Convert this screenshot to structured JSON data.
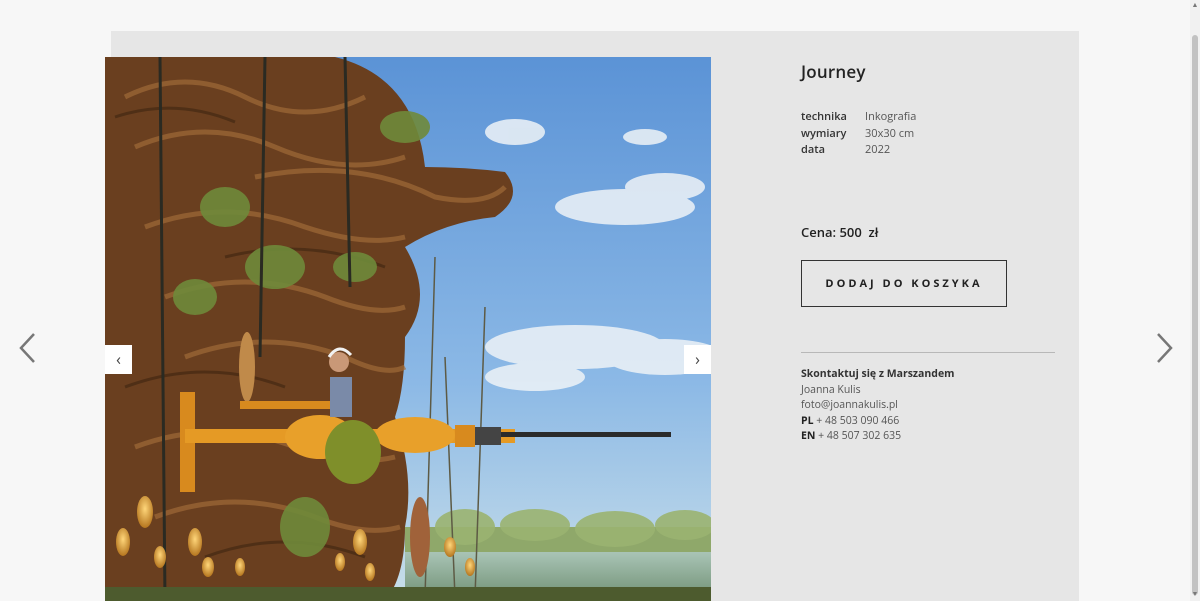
{
  "artwork": {
    "title": "Journey",
    "specs": [
      {
        "label": "technika",
        "value": "Inkografia"
      },
      {
        "label": "wymiary",
        "value": "30x30 cm"
      },
      {
        "label": "data",
        "value": "2022"
      }
    ],
    "price": "Cena: 500  zł",
    "add_to_cart_label": "DODAJ DO KOSZYKA"
  },
  "contact": {
    "heading": "Skontaktuj się z Marszandem",
    "name": "Joanna Kulis",
    "email": "foto@joannakulis.pl",
    "phones": [
      {
        "prefix": "PL",
        "number": "+ 48 503 090 466"
      },
      {
        "prefix": "EN",
        "number": "+ 48 507 302 635"
      }
    ]
  },
  "image_nav": {
    "prev": "‹",
    "next": "›"
  },
  "icons": {
    "prev_artwork": "chevron-left-icon",
    "next_artwork": "chevron-right-icon"
  }
}
